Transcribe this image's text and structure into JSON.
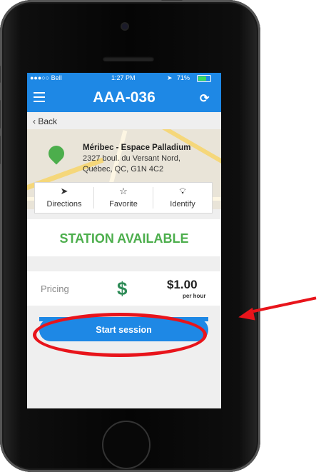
{
  "status_bar": {
    "carrier": "●●●○○ Bell",
    "time": "1:27 PM",
    "battery": "71%",
    "battery_level": 0.71
  },
  "nav": {
    "title": "AAA-036",
    "menu_icon": "hamburger-menu-icon",
    "refresh_icon": "refresh-icon"
  },
  "back_label": "Back",
  "station": {
    "name": "Méribec - Espace Palladium",
    "address_line1": "2327 boul. du Versant Nord,",
    "address_line2": "Québec, QC, G1N 4C2"
  },
  "actions": [
    {
      "label": "Directions",
      "icon": "navigation-arrow-icon"
    },
    {
      "label": "Favorite",
      "icon": "star-icon"
    },
    {
      "label": "Identify",
      "icon": "lightbulb-icon"
    }
  ],
  "availability": "STATION AVAILABLE",
  "pricing": {
    "label": "Pricing",
    "amount": "$1.00",
    "unit": "per hour"
  },
  "start_session_label": "Start session",
  "colors": {
    "primary": "#1e88e5",
    "available": "#4cae4c",
    "annotation": "#e8141b"
  }
}
